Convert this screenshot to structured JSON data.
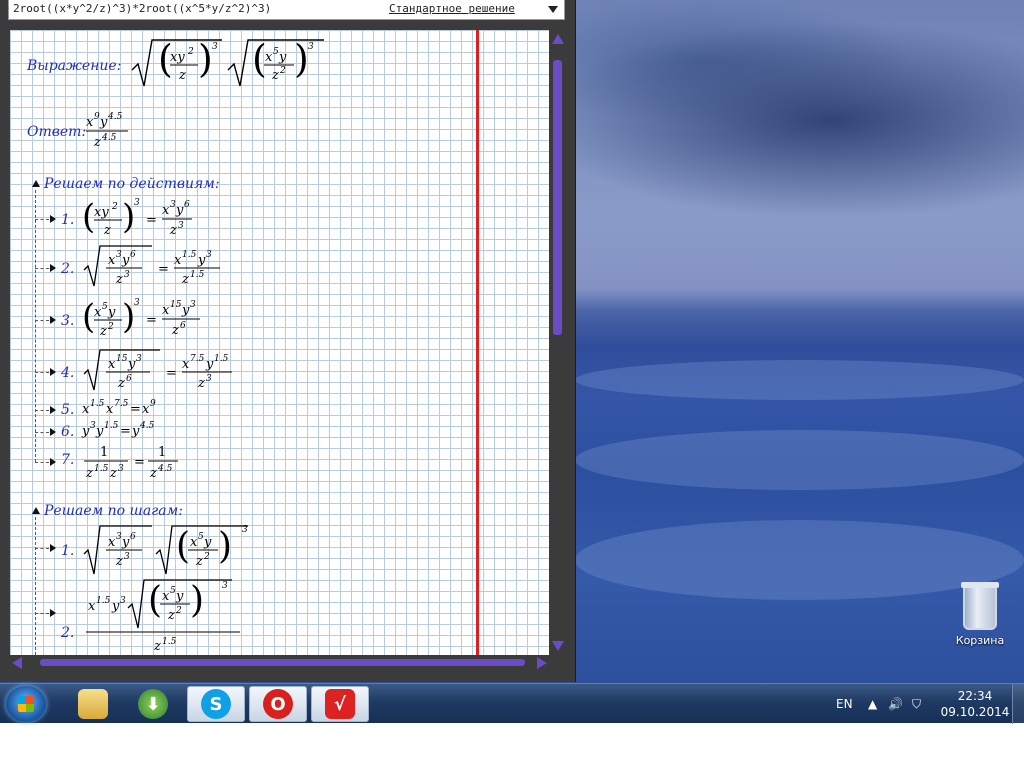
{
  "app": {
    "expression_input": "2root((x*y^2/z)^3)*2root((x^5*y/z^2)^3)",
    "mode_select": "Стандартное решение"
  },
  "worksheet": {
    "expression_label": "Выражение:",
    "expression": "√((xy²/z)³)·√((x⁵y/z²)³)",
    "answer_label": "Ответ:",
    "answer": "x⁹y⁴·⁵ / z⁴·⁵",
    "by_actions": {
      "heading": "Решаем по действиям:",
      "items": [
        {
          "n": "1.",
          "expr": "(xy²/z)³ = x³y⁶/z³"
        },
        {
          "n": "2.",
          "expr": "√(x³y⁶/z³) = x¹·⁵y³/z¹·⁵"
        },
        {
          "n": "3.",
          "expr": "(x⁵y/z²)³ = x¹⁵y³/z⁶"
        },
        {
          "n": "4.",
          "expr": "√(x¹⁵y³/z⁶) = x⁷·⁵y¹·⁵/z³"
        },
        {
          "n": "5.",
          "expr": "x¹·⁵x⁷·⁵ = x⁹"
        },
        {
          "n": "6.",
          "expr": "y³y¹·⁵ = y⁴·⁵"
        },
        {
          "n": "7.",
          "expr": "1/(z¹·⁵z³) = 1/z⁴·⁵"
        }
      ]
    },
    "by_steps": {
      "heading": "Решаем по шагам:",
      "items": [
        {
          "n": "1.",
          "expr": "√(x³y⁶/z³)·√((x⁵y/z²)³)"
        },
        {
          "n": "2.",
          "expr": "x¹·⁵y³·√((x⁵y/z²)³) / z¹·⁵"
        }
      ]
    }
  },
  "desktop": {
    "recycle_bin_label": "Корзина"
  },
  "taskbar": {
    "apps": [
      "file-explorer",
      "downloader",
      "skype",
      "opera",
      "math-solver"
    ],
    "language": "EN",
    "time": "22:34",
    "date": "09.10.2014"
  },
  "colors": {
    "scrollbar": "#6a4cc6",
    "margin_line": "#e02020",
    "label_text": "#1f2fb8",
    "grid": "#b9cbe0"
  }
}
